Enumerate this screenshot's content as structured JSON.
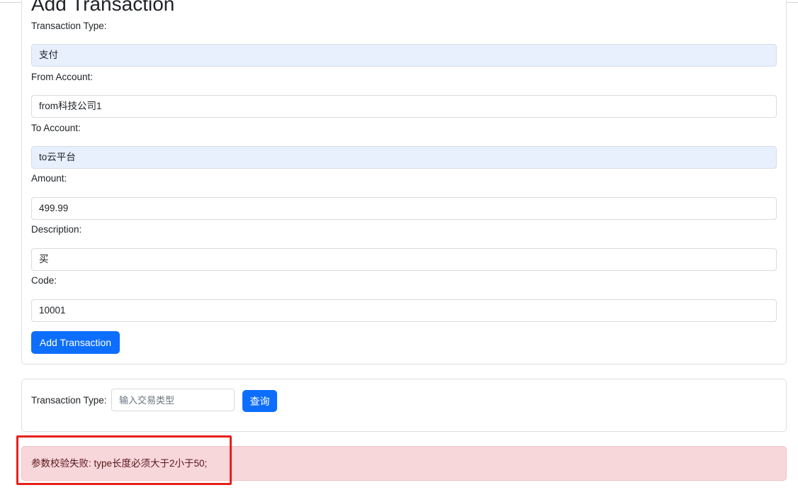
{
  "form": {
    "title": "Add Transaction",
    "type_label": "Transaction Type:",
    "type_value": "支付",
    "from_label": "From Account:",
    "from_value": "from科技公司1",
    "to_label": "To Account:",
    "to_value": "to云平台",
    "amount_label": "Amount:",
    "amount_value": "499.99",
    "description_label": "Description:",
    "description_value": "买",
    "code_label": "Code:",
    "code_value": "10001",
    "submit_label": "Add Transaction"
  },
  "search": {
    "label": "Transaction Type:",
    "placeholder": "输入交易类型",
    "button_label": "查询"
  },
  "alert": {
    "message": "参数校验失败: type长度必须大于2小于50;"
  },
  "colors": {
    "primary": "#0d6efd",
    "autofill": "#e8f0fe",
    "alert_bg": "#f8d7da",
    "alert_text": "#58151c",
    "highlight_border": "#e8201b"
  }
}
